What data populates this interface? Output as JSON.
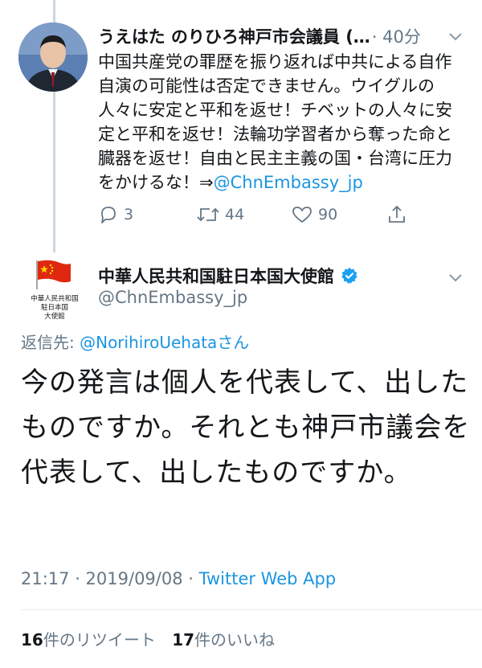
{
  "tweet1": {
    "name": "うえはた のりひろ神戸市会議員 (…",
    "time": "· 40分",
    "body_text": "中国共産党の罪歴を振り返れば中共による自作自演の可能性は否定できません。ウイグルの人々に安定と平和を返せ！チベットの人々に安定と平和を返せ！法輪功学習者から奪った命と臓器を返せ！自由と民主主義の国・台湾に圧力をかけるな！⇒",
    "body_link": "@ChnEmbassy_jp",
    "reply_count": "3",
    "retweet_count": "44",
    "like_count": "90"
  },
  "tweet2": {
    "name": "中華人民共和国駐日本国大使館",
    "handle": "@ChnEmbassy_jp",
    "avatar_caption_line1": "中華人民共和国",
    "avatar_caption_line2": "駐日本国",
    "avatar_caption_line3": "大使館",
    "reply_prefix": "返信先: ",
    "reply_link": "@NorihiroUehata",
    "reply_suffix": "さん",
    "text": "今の発言は個人を代表して、出したものですか。それとも神戸市議会を代表して、出したものですか。",
    "timestamp": "21:17 · 2019/09/08 · ",
    "source": "Twitter Web App",
    "retweets_number": "16",
    "retweets_label": "件のリツイート",
    "likes_number": "17",
    "likes_label": "件のいいね"
  },
  "colors": {
    "link": "#1b95e0",
    "secondary": "#657786",
    "text": "#14171a",
    "verified": "#1da1f2",
    "flag_red": "#de2910",
    "flag_star": "#ffde00"
  }
}
